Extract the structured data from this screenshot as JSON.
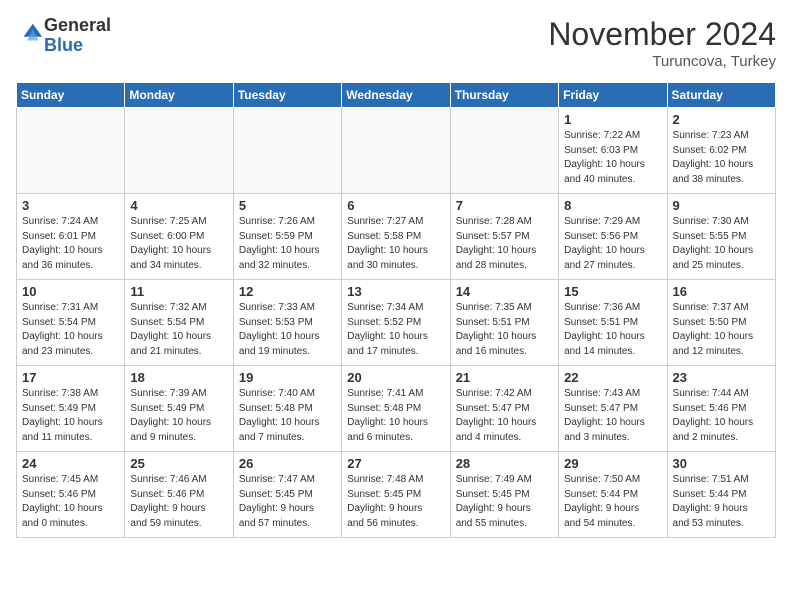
{
  "header": {
    "logo_general": "General",
    "logo_blue": "Blue",
    "title": "November 2024",
    "location": "Turuncova, Turkey"
  },
  "days_of_week": [
    "Sunday",
    "Monday",
    "Tuesday",
    "Wednesday",
    "Thursday",
    "Friday",
    "Saturday"
  ],
  "weeks": [
    [
      {
        "day": "",
        "info": ""
      },
      {
        "day": "",
        "info": ""
      },
      {
        "day": "",
        "info": ""
      },
      {
        "day": "",
        "info": ""
      },
      {
        "day": "",
        "info": ""
      },
      {
        "day": "1",
        "info": "Sunrise: 7:22 AM\nSunset: 6:03 PM\nDaylight: 10 hours\nand 40 minutes."
      },
      {
        "day": "2",
        "info": "Sunrise: 7:23 AM\nSunset: 6:02 PM\nDaylight: 10 hours\nand 38 minutes."
      }
    ],
    [
      {
        "day": "3",
        "info": "Sunrise: 7:24 AM\nSunset: 6:01 PM\nDaylight: 10 hours\nand 36 minutes."
      },
      {
        "day": "4",
        "info": "Sunrise: 7:25 AM\nSunset: 6:00 PM\nDaylight: 10 hours\nand 34 minutes."
      },
      {
        "day": "5",
        "info": "Sunrise: 7:26 AM\nSunset: 5:59 PM\nDaylight: 10 hours\nand 32 minutes."
      },
      {
        "day": "6",
        "info": "Sunrise: 7:27 AM\nSunset: 5:58 PM\nDaylight: 10 hours\nand 30 minutes."
      },
      {
        "day": "7",
        "info": "Sunrise: 7:28 AM\nSunset: 5:57 PM\nDaylight: 10 hours\nand 28 minutes."
      },
      {
        "day": "8",
        "info": "Sunrise: 7:29 AM\nSunset: 5:56 PM\nDaylight: 10 hours\nand 27 minutes."
      },
      {
        "day": "9",
        "info": "Sunrise: 7:30 AM\nSunset: 5:55 PM\nDaylight: 10 hours\nand 25 minutes."
      }
    ],
    [
      {
        "day": "10",
        "info": "Sunrise: 7:31 AM\nSunset: 5:54 PM\nDaylight: 10 hours\nand 23 minutes."
      },
      {
        "day": "11",
        "info": "Sunrise: 7:32 AM\nSunset: 5:54 PM\nDaylight: 10 hours\nand 21 minutes."
      },
      {
        "day": "12",
        "info": "Sunrise: 7:33 AM\nSunset: 5:53 PM\nDaylight: 10 hours\nand 19 minutes."
      },
      {
        "day": "13",
        "info": "Sunrise: 7:34 AM\nSunset: 5:52 PM\nDaylight: 10 hours\nand 17 minutes."
      },
      {
        "day": "14",
        "info": "Sunrise: 7:35 AM\nSunset: 5:51 PM\nDaylight: 10 hours\nand 16 minutes."
      },
      {
        "day": "15",
        "info": "Sunrise: 7:36 AM\nSunset: 5:51 PM\nDaylight: 10 hours\nand 14 minutes."
      },
      {
        "day": "16",
        "info": "Sunrise: 7:37 AM\nSunset: 5:50 PM\nDaylight: 10 hours\nand 12 minutes."
      }
    ],
    [
      {
        "day": "17",
        "info": "Sunrise: 7:38 AM\nSunset: 5:49 PM\nDaylight: 10 hours\nand 11 minutes."
      },
      {
        "day": "18",
        "info": "Sunrise: 7:39 AM\nSunset: 5:49 PM\nDaylight: 10 hours\nand 9 minutes."
      },
      {
        "day": "19",
        "info": "Sunrise: 7:40 AM\nSunset: 5:48 PM\nDaylight: 10 hours\nand 7 minutes."
      },
      {
        "day": "20",
        "info": "Sunrise: 7:41 AM\nSunset: 5:48 PM\nDaylight: 10 hours\nand 6 minutes."
      },
      {
        "day": "21",
        "info": "Sunrise: 7:42 AM\nSunset: 5:47 PM\nDaylight: 10 hours\nand 4 minutes."
      },
      {
        "day": "22",
        "info": "Sunrise: 7:43 AM\nSunset: 5:47 PM\nDaylight: 10 hours\nand 3 minutes."
      },
      {
        "day": "23",
        "info": "Sunrise: 7:44 AM\nSunset: 5:46 PM\nDaylight: 10 hours\nand 2 minutes."
      }
    ],
    [
      {
        "day": "24",
        "info": "Sunrise: 7:45 AM\nSunset: 5:46 PM\nDaylight: 10 hours\nand 0 minutes."
      },
      {
        "day": "25",
        "info": "Sunrise: 7:46 AM\nSunset: 5:46 PM\nDaylight: 9 hours\nand 59 minutes."
      },
      {
        "day": "26",
        "info": "Sunrise: 7:47 AM\nSunset: 5:45 PM\nDaylight: 9 hours\nand 57 minutes."
      },
      {
        "day": "27",
        "info": "Sunrise: 7:48 AM\nSunset: 5:45 PM\nDaylight: 9 hours\nand 56 minutes."
      },
      {
        "day": "28",
        "info": "Sunrise: 7:49 AM\nSunset: 5:45 PM\nDaylight: 9 hours\nand 55 minutes."
      },
      {
        "day": "29",
        "info": "Sunrise: 7:50 AM\nSunset: 5:44 PM\nDaylight: 9 hours\nand 54 minutes."
      },
      {
        "day": "30",
        "info": "Sunrise: 7:51 AM\nSunset: 5:44 PM\nDaylight: 9 hours\nand 53 minutes."
      }
    ]
  ]
}
